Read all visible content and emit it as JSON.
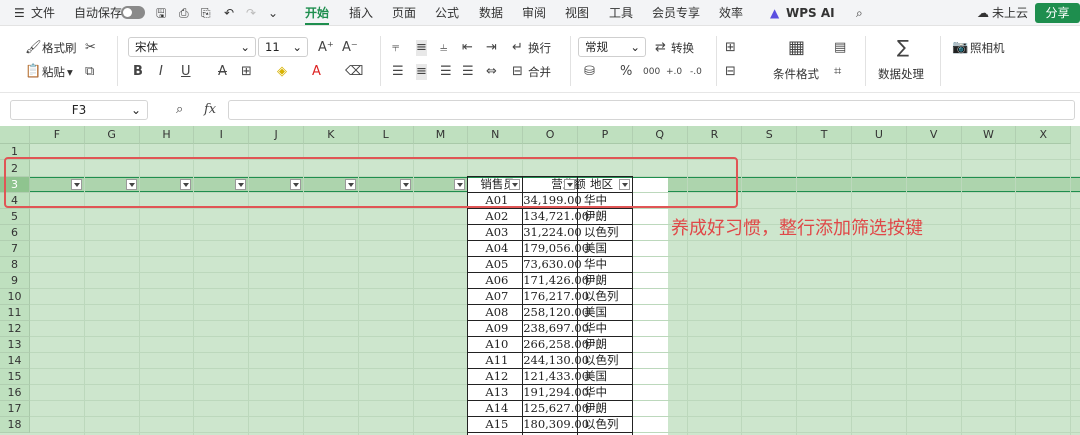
{
  "topbar": {
    "menu_file": "文件",
    "autosave_label": "自动保存",
    "tabs": [
      "开始",
      "插入",
      "页面",
      "公式",
      "数据",
      "审阅",
      "视图",
      "工具",
      "会员专享",
      "效率"
    ],
    "wps_ai": "WPS AI",
    "cloud_status": "未上云",
    "share_label": "分享"
  },
  "ribbon": {
    "format_painter": "格式刷",
    "paste": "粘贴",
    "font_name": "宋体",
    "font_size": "11",
    "wrap": "换行",
    "merge": "合并",
    "number_format": "常规",
    "convert": "转换",
    "conditional_format": "条件格式",
    "data_processing": "数据处理",
    "camera": "照相机",
    "bold": "B",
    "italic": "I",
    "underline": "U",
    "strike": "A",
    "percent": "%",
    "thousands": "000",
    "dec_inc": "+.0",
    "dec_dec": "-.0"
  },
  "formula_bar": {
    "cell_ref": "F3",
    "fx_label": "fx",
    "value": ""
  },
  "sheet": {
    "columns": [
      "F",
      "G",
      "H",
      "I",
      "J",
      "K",
      "L",
      "M",
      "N",
      "O",
      "P",
      "Q",
      "R",
      "S",
      "T",
      "U",
      "V",
      "W",
      "X"
    ],
    "rows": [
      "1",
      "2",
      "3",
      "4",
      "5",
      "6",
      "7",
      "8",
      "9",
      "10",
      "11",
      "12",
      "13",
      "14",
      "15",
      "16",
      "17",
      "18"
    ],
    "headers": [
      "销售员",
      "营业额",
      "地区"
    ],
    "data": [
      [
        "A01",
        "34,199.00",
        "华中"
      ],
      [
        "A02",
        "134,721.00",
        "伊朗"
      ],
      [
        "A03",
        "31,224.00",
        "以色列"
      ],
      [
        "A04",
        "179,056.00",
        "美国"
      ],
      [
        "A05",
        "73,630.00",
        "华中"
      ],
      [
        "A06",
        "171,426.00",
        "伊朗"
      ],
      [
        "A07",
        "176,217.00",
        "以色列"
      ],
      [
        "A08",
        "258,120.00",
        "美国"
      ],
      [
        "A09",
        "238,697.00",
        "华中"
      ],
      [
        "A10",
        "266,258.00",
        "伊朗"
      ],
      [
        "A11",
        "244,130.00",
        "以色列"
      ],
      [
        "A12",
        "121,433.00",
        "美国"
      ],
      [
        "A13",
        "191,294.00",
        "华中"
      ],
      [
        "A14",
        "125,627.00",
        "伊朗"
      ],
      [
        "A15",
        "180,309.00",
        "以色列"
      ]
    ]
  },
  "annotation": {
    "text": "养成好习惯，整行添加筛选按键",
    "color": "#e04848"
  },
  "colors": {
    "accent": "#1e8e4e",
    "sheet_bg": "#cde6cd",
    "highlight_box": "#e05555"
  }
}
